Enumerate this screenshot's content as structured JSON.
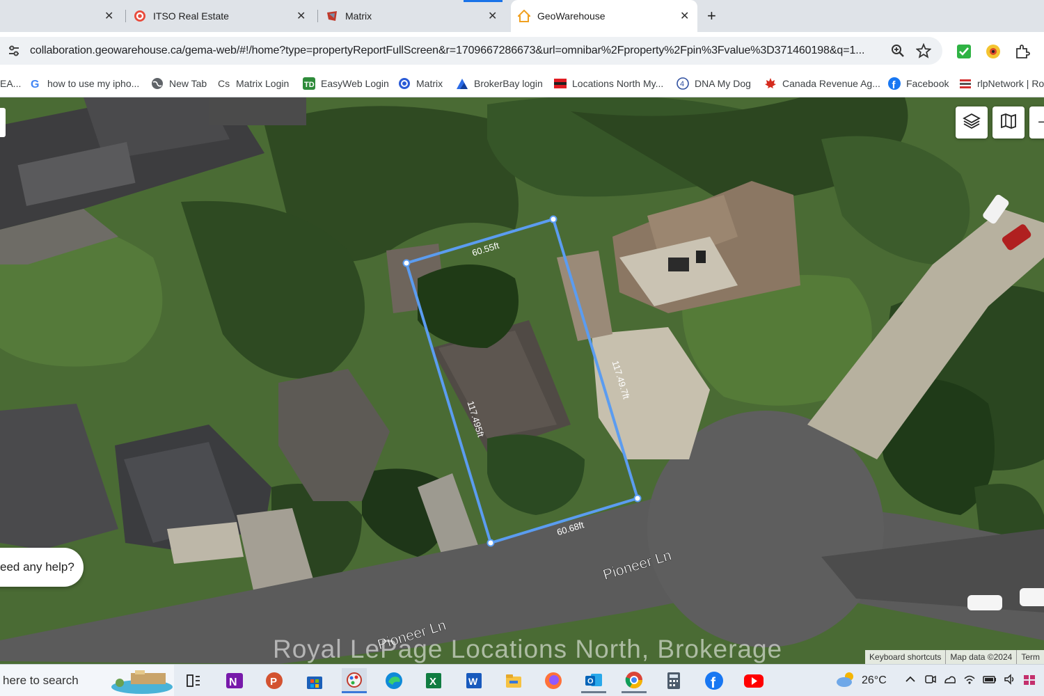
{
  "browser": {
    "tabs": [
      {
        "title": "",
        "close": "✕"
      },
      {
        "title": "ITSO Real Estate",
        "close": "✕"
      },
      {
        "title": "Matrix",
        "close": "✕"
      },
      {
        "title": "GeoWarehouse",
        "close": "✕",
        "active": true
      }
    ],
    "new_tab": "+",
    "url": "collaboration.geowarehouse.ca/gema-web/#!/home?type=propertyReportFullScreen&r=1709667286673&url=omnibar%2Fproperty%2Fpin%3Fvalue%3D371460198&q=1..."
  },
  "bookmarks": [
    {
      "label": "EA...",
      "icon": "bookmark-icon"
    },
    {
      "label": "how to use my ipho...",
      "icon": "google-icon"
    },
    {
      "label": "New Tab",
      "icon": "globe-icon"
    },
    {
      "label": "Matrix Login",
      "icon": "matrix-cs-icon"
    },
    {
      "label": "EasyWeb Login",
      "icon": "td-icon"
    },
    {
      "label": "Matrix",
      "icon": "matrix-icon"
    },
    {
      "label": "BrokerBay login",
      "icon": "brokerbay-icon"
    },
    {
      "label": "Locations North My...",
      "icon": "locations-north-icon"
    },
    {
      "label": "DNA My Dog",
      "icon": "dna-icon"
    },
    {
      "label": "Canada Revenue Ag...",
      "icon": "maple-leaf-icon"
    },
    {
      "label": "Facebook",
      "icon": "facebook-icon"
    },
    {
      "label": "rlpNetwork | Ro",
      "icon": "rlp-icon"
    }
  ],
  "map": {
    "measurements": {
      "top": "60.55ft",
      "right": "117.49.7ft",
      "left": "117.495ft",
      "bottom": "60.68ft"
    },
    "streets": [
      "Pioneer Ln",
      "Pioneer Ln"
    ],
    "help_text": "eed any help?",
    "watermark": "Royal LePage Locations North, Brokerage",
    "attribution": [
      "Keyboard shortcuts",
      "Map data ©2024",
      "Term"
    ],
    "controls": [
      "layers-icon",
      "map-icon"
    ]
  },
  "taskbar": {
    "search_placeholder": "here to search",
    "weather": "26°C",
    "apps": [
      "task-view-icon",
      "onenote-icon",
      "powerpoint-icon",
      "store-icon",
      "paint-icon",
      "edge-icon",
      "excel-icon",
      "word-icon",
      "file-explorer-icon",
      "firefox-icon",
      "outlook-icon",
      "chrome-icon",
      "calculator-icon",
      "facebook-icon",
      "youtube-icon"
    ]
  },
  "colors": {
    "parcel_line": "#5b9cf0",
    "tab_active": "#ffffff",
    "tab_strip": "#dfe3e8"
  }
}
